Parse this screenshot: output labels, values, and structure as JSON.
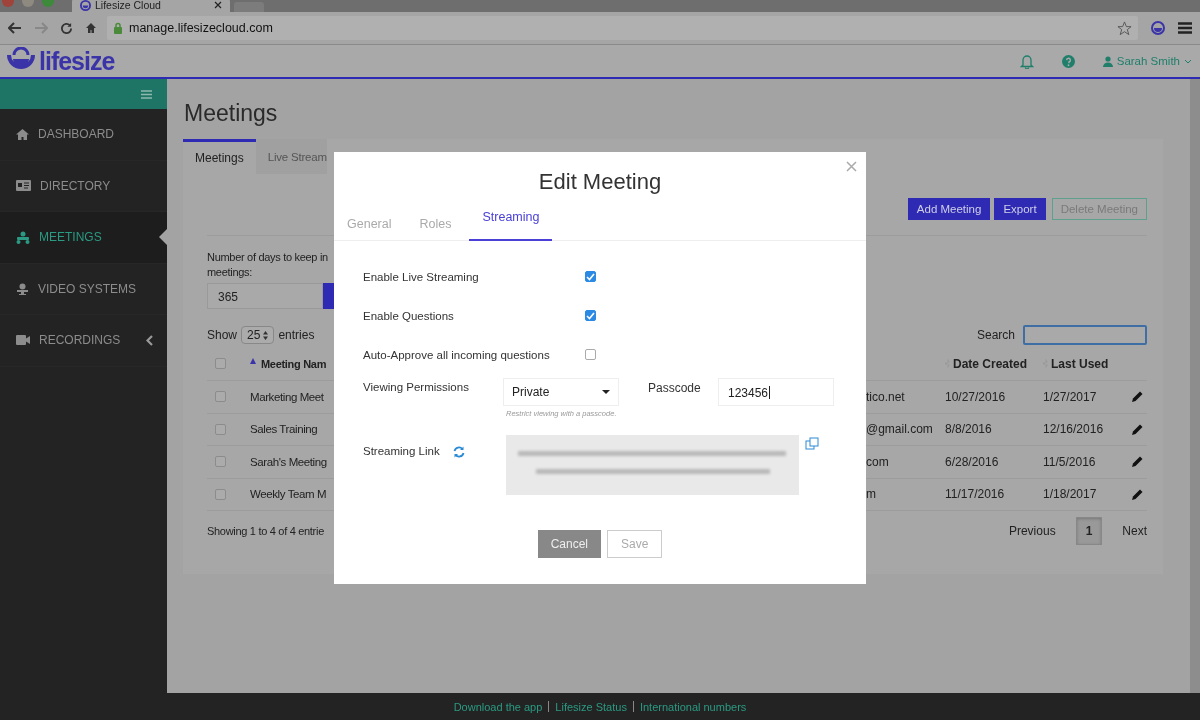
{
  "browser": {
    "tab_title": "Lifesize Cloud",
    "url": "manage.lifesizecloud.com"
  },
  "header": {
    "logo_text": "lifesize",
    "user_name": "Sarah Smith"
  },
  "sidebar": {
    "items": [
      {
        "label": "DASHBOARD",
        "selected": false,
        "has_chevron": false
      },
      {
        "label": "DIRECTORY",
        "selected": false,
        "has_chevron": false
      },
      {
        "label": "MEETINGS",
        "selected": true,
        "has_chevron": false
      },
      {
        "label": "VIDEO SYSTEMS",
        "selected": false,
        "has_chevron": false
      },
      {
        "label": "RECORDINGS",
        "selected": false,
        "has_chevron": true
      }
    ]
  },
  "page": {
    "title": "Meetings",
    "tabs": [
      {
        "label": "Meetings",
        "selected": true
      },
      {
        "label": "Live Stream",
        "selected": false
      }
    ],
    "actions": [
      {
        "label": "Add Meeting",
        "kind": "primary"
      },
      {
        "label": "Export",
        "kind": "primary"
      },
      {
        "label": "Delete Meeting",
        "kind": "outline"
      }
    ],
    "retention": {
      "label": "Number of days to keep in\nmeetings:",
      "value": "365"
    },
    "show": {
      "prefix": "Show",
      "value": "25",
      "suffix": "entries"
    },
    "search": {
      "label": "Search"
    },
    "table": {
      "select_all_checked": false,
      "columns": [
        {
          "label": "Meeting Nam",
          "sorted": true
        },
        {
          "label": "Date Created",
          "sorted": false
        },
        {
          "label": "Last Used",
          "sorted": false
        }
      ],
      "rows": [
        {
          "checked": false,
          "name": "Marketing Meet",
          "column_3": "tico.net",
          "created": "10/27/2016",
          "last_used": "1/27/2017"
        },
        {
          "checked": false,
          "name": "Sales Training",
          "column_3": "@gmail.com",
          "created": "8/8/2016",
          "last_used": "12/16/2016"
        },
        {
          "checked": false,
          "name": "Sarah's Meeting",
          "column_3": "com",
          "created": "6/28/2016",
          "last_used": "11/5/2016"
        },
        {
          "checked": false,
          "name": "Weekly Team M",
          "column_3": "m",
          "created": "11/17/2016",
          "last_used": "1/18/2017"
        }
      ]
    },
    "info": "Showing 1 to 4 of 4 entrie",
    "pagination": {
      "previous": "Previous",
      "pages": [
        {
          "label": "1",
          "selected": true
        }
      ],
      "next": "Next"
    }
  },
  "modal": {
    "title": "Edit Meeting",
    "tabs": [
      {
        "label": "General",
        "selected": false
      },
      {
        "label": "Roles",
        "selected": false
      },
      {
        "label": "Streaming",
        "selected": true
      }
    ],
    "options": [
      {
        "label": "Enable Live Streaming",
        "checked": true
      },
      {
        "label": "Enable Questions",
        "checked": true
      },
      {
        "label": "Auto-Approve all incoming questions",
        "checked": false
      }
    ],
    "permissions": {
      "label": "Viewing Permissions",
      "value": "Private",
      "hint": "Restrict viewing with a passcode."
    },
    "passcode": {
      "label": "Passcode",
      "value": "123456"
    },
    "link": {
      "label": "Streaming Link"
    },
    "buttons": [
      {
        "label": "Cancel",
        "kind": "primary"
      },
      {
        "label": "Save",
        "kind": "outline"
      }
    ]
  },
  "footer": {
    "links": [
      "Download the app",
      "Lifesize Status",
      "International numbers"
    ]
  }
}
